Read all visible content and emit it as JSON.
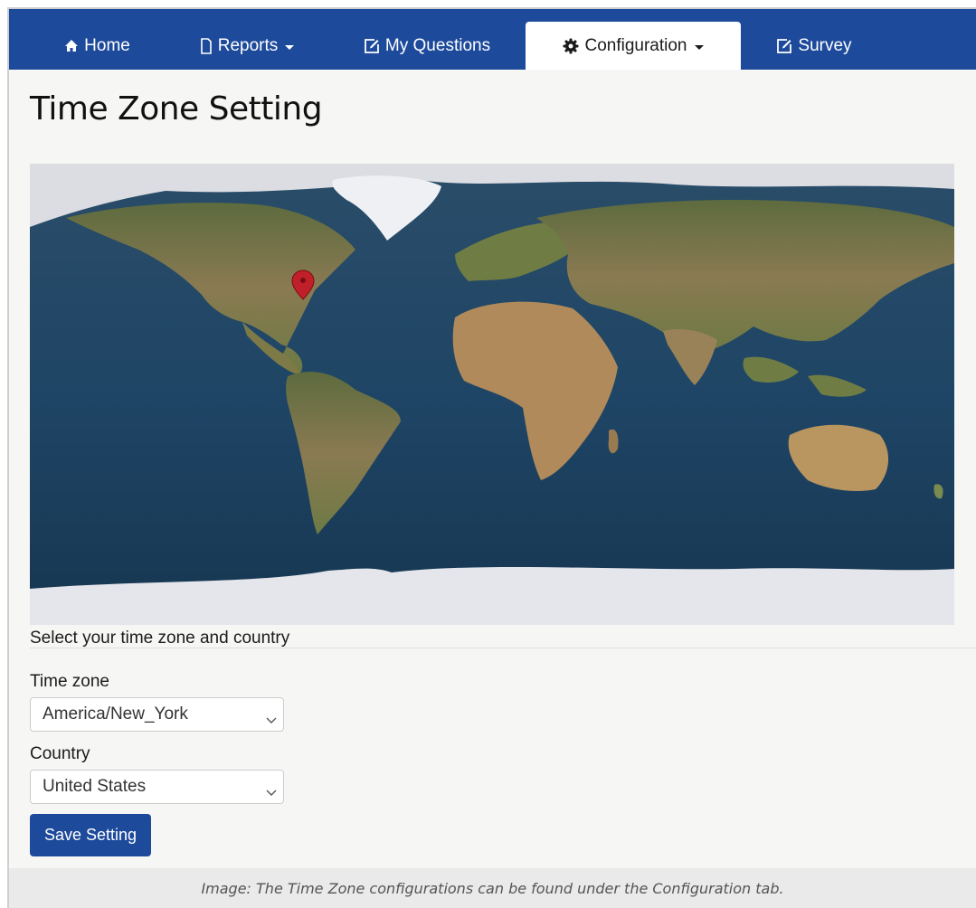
{
  "nav": {
    "home": "Home",
    "reports": "Reports",
    "my_questions": "My Questions",
    "configuration": "Configuration",
    "survey": "Survey"
  },
  "icons": {
    "home": "home-icon",
    "reports": "file-icon",
    "my_questions": "edit-icon",
    "configuration": "gear-icon",
    "survey": "edit-icon",
    "dropdown": "chevron-down-icon",
    "map_marker": "map-marker-icon"
  },
  "page": {
    "title": "Time Zone Setting",
    "instruction": "Select your time zone and country"
  },
  "form": {
    "timezone_label": "Time zone",
    "timezone_value": "America/New_York",
    "country_label": "Country",
    "country_value": "United States",
    "save_label": "Save Setting"
  },
  "caption": "Image: The Time Zone configurations can be found under the Configuration tab.",
  "colors": {
    "nav_bg": "#1d4a9b",
    "button_bg": "#1d4a9b",
    "marker": "#c0202a"
  }
}
